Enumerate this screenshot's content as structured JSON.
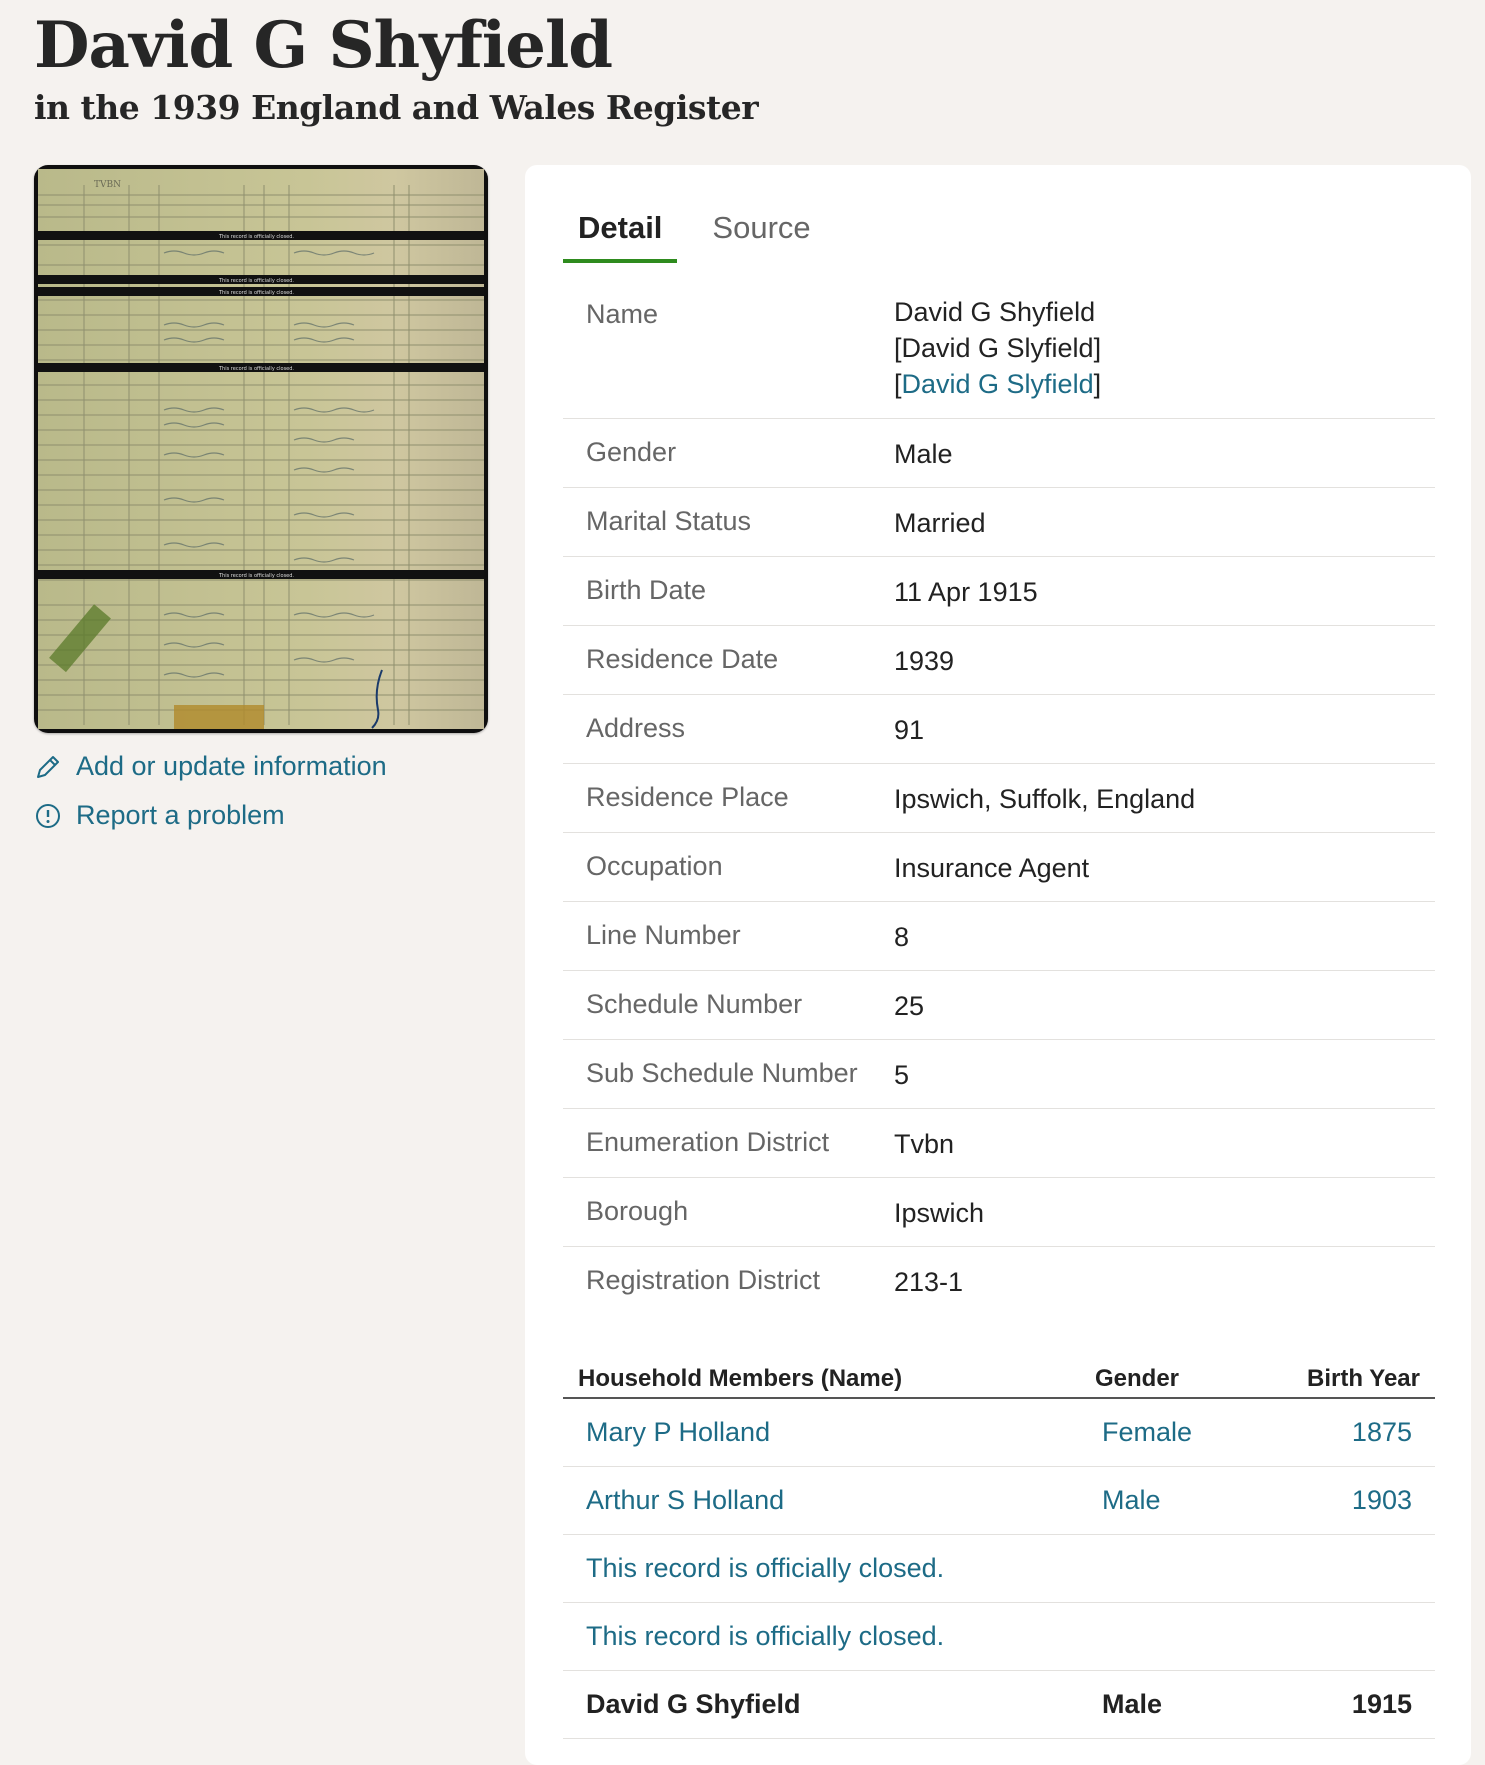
{
  "header": {
    "title": "David G Shyfield",
    "subtitle": "in the 1939 England and Wales Register"
  },
  "actions": {
    "add_update": "Add or update information",
    "report": "Report a problem"
  },
  "thumbnail": {
    "header_code": "TVBN",
    "closed_note": "This record is officially closed."
  },
  "tabs": {
    "detail": "Detail",
    "source": "Source"
  },
  "details": {
    "name_label": "Name",
    "name_line1": "David G Shyfield",
    "name_line2": "[David G Slyfield]",
    "name_line3_open": "[",
    "name_line3_link": "David G Slyfield",
    "name_line3_close": "]",
    "gender_label": "Gender",
    "gender": "Male",
    "marital_label": "Marital Status",
    "marital": "Married",
    "birth_label": "Birth Date",
    "birth": "11 Apr 1915",
    "resdate_label": "Residence Date",
    "resdate": "1939",
    "address_label": "Address",
    "address": "91",
    "resplace_label": "Residence Place",
    "resplace": "Ipswich, Suffolk, England",
    "occupation_label": "Occupation",
    "occupation": "Insurance Agent",
    "line_label": "Line Number",
    "line": "8",
    "schedule_label": "Schedule Number",
    "schedule": "25",
    "subschedule_label": "Sub Schedule Number",
    "subschedule": "5",
    "enum_label": "Enumeration District",
    "enum": "Tvbn",
    "borough_label": "Borough",
    "borough": "Ipswich",
    "regdist_label": "Registration District",
    "regdist": "213-1"
  },
  "household": {
    "col_name": "Household Members (Name)",
    "col_gender": "Gender",
    "col_birth": "Birth Year",
    "rows": [
      {
        "name": "Mary P Holland",
        "gender": "Female",
        "year": "1875"
      },
      {
        "name": "Arthur S Holland",
        "gender": "Male",
        "year": "1903"
      },
      {
        "name": "This record is officially closed.",
        "gender": "",
        "year": ""
      },
      {
        "name": "This record is officially closed.",
        "gender": "",
        "year": ""
      },
      {
        "name": "David G Shyfield",
        "gender": "Male",
        "year": "1915"
      }
    ]
  },
  "colors": {
    "link": "#1d6b86",
    "tab_accent": "#2e8b1e",
    "page_bg": "#f5f2ef"
  }
}
